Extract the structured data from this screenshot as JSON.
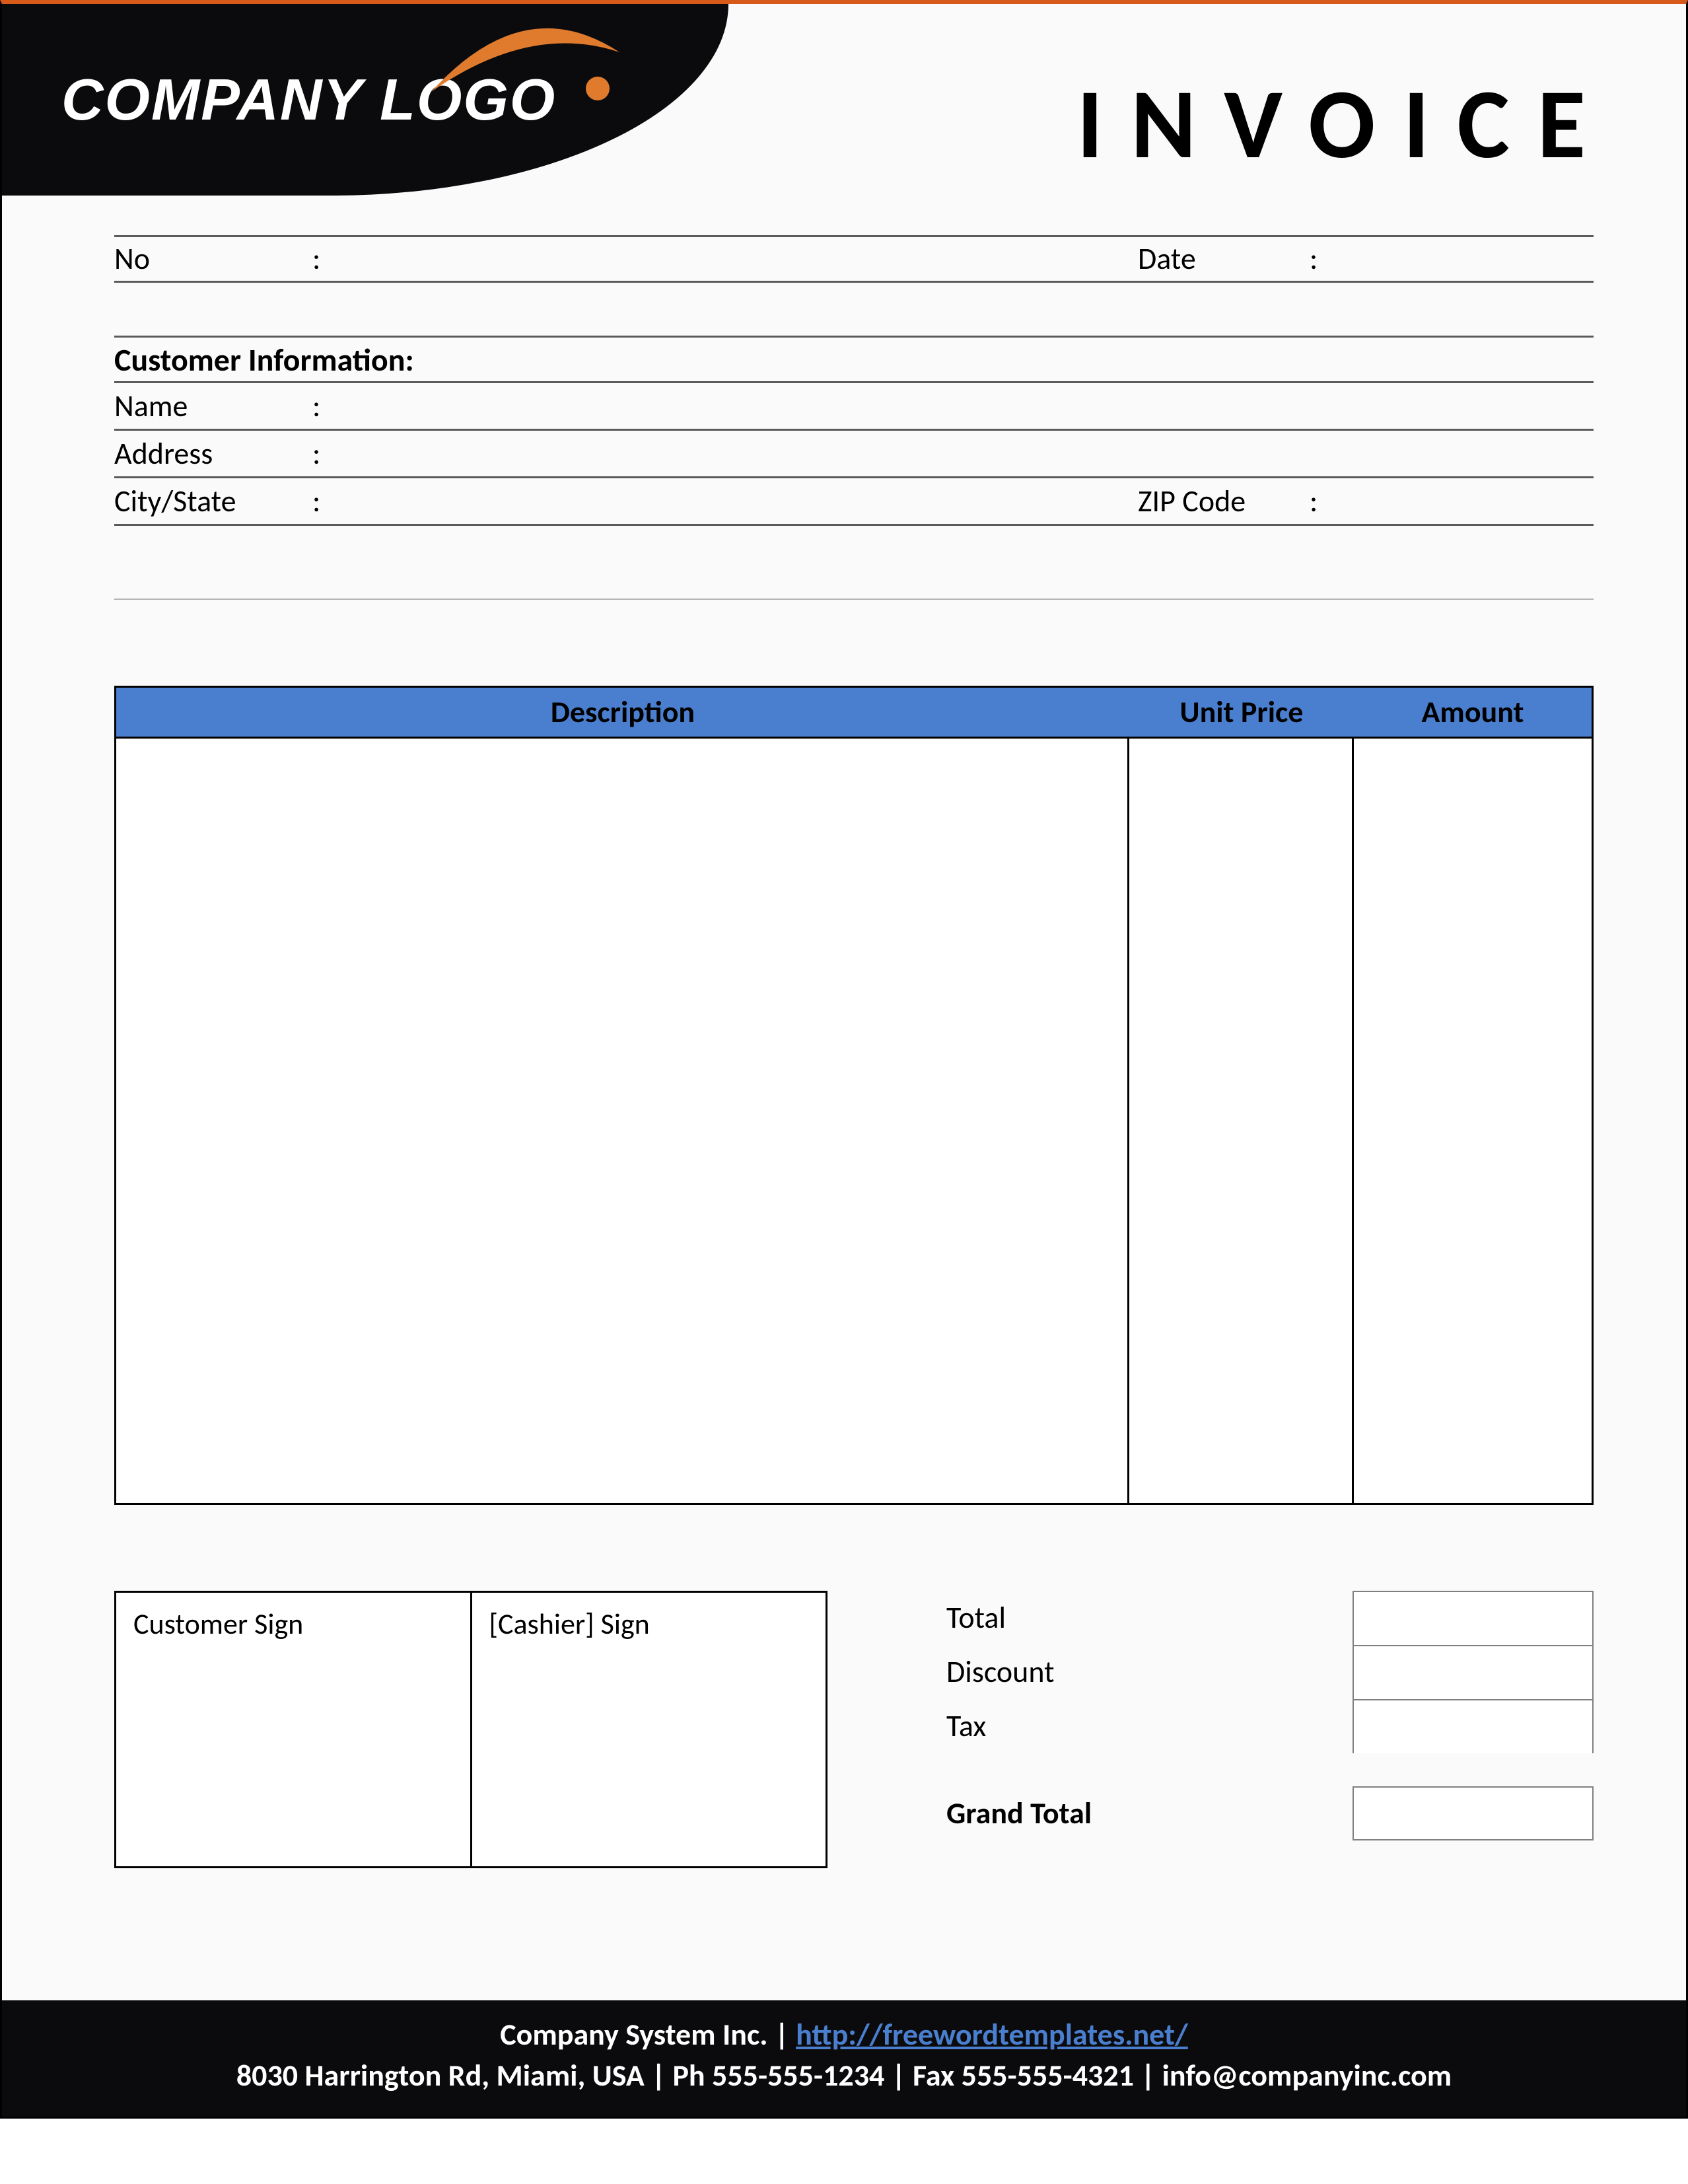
{
  "header": {
    "logo_text": "COMPANY LOGO",
    "title": "INVOICE"
  },
  "meta": {
    "no_label": "No",
    "date_label": "Date",
    "colon": ":"
  },
  "customer": {
    "section_title": "Customer Information:",
    "name_label": "Name",
    "address_label": "Address",
    "city_state_label": "City/State",
    "zip_label": "ZIP Code",
    "colon": ":"
  },
  "items": {
    "col_description": "Description",
    "col_unit_price": "Unit Price",
    "col_amount": "Amount"
  },
  "signatures": {
    "customer_sign": "Customer Sign",
    "cashier_sign": "[Cashier] Sign"
  },
  "totals": {
    "total_label": "Total",
    "discount_label": "Discount",
    "tax_label": "Tax",
    "grand_total_label": "Grand Total"
  },
  "footer": {
    "company": "Company System Inc.",
    "sep": " | ",
    "url": "http://freewordtemplates.net/",
    "address_line": "8030 Harrington Rd, Miami, USA | Ph 555-555-1234 | Fax 555-555-4321 | info@companyinc.com"
  }
}
